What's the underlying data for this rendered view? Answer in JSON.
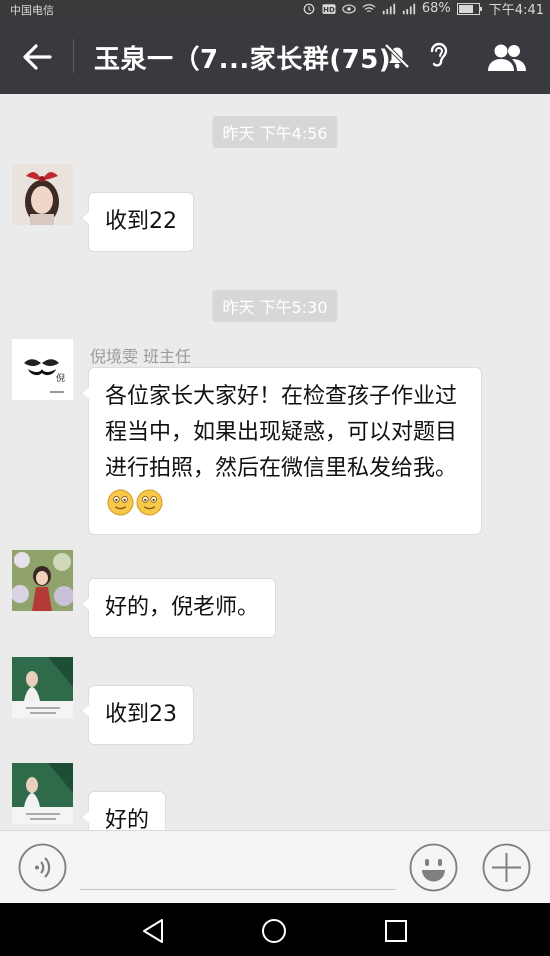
{
  "status_bar": {
    "carrier": "中国电信",
    "battery": "68%",
    "time": "下午4:41"
  },
  "header": {
    "title": "玉泉一（7...家长群(75)",
    "icons": [
      "back-arrow-icon",
      "mute-bell-icon",
      "ear-icon",
      "group-members-icon"
    ]
  },
  "chat": {
    "timestamps": [
      "昨天 下午4:56",
      "昨天 下午5:30"
    ],
    "messages": [
      {
        "sender": "",
        "text": "收到22"
      },
      {
        "sender": "倪境雯 班主任",
        "text": "各位家长大家好！在检查孩子作业过程当中，如果出现疑惑，可以对题目进行拍照，然后在微信里私发给我。"
      },
      {
        "sender": "",
        "text": "好的，倪老师。"
      },
      {
        "sender": "",
        "text": "收到23"
      },
      {
        "sender": "",
        "text": "好的"
      }
    ],
    "emoji_suffix": [
      "smiley-emoji",
      "smiley-emoji"
    ]
  },
  "input_bar": {
    "icons": [
      "voice-icon",
      "emoji-icon",
      "plus-icon"
    ]
  },
  "nav_bar": {
    "icons": [
      "nav-back-icon",
      "nav-home-icon",
      "nav-recent-icon"
    ]
  },
  "colors": {
    "header_bg": "#393a3f",
    "chat_bg": "#ebebeb",
    "bubble_bg": "#ffffff",
    "timestamp_bg": "#d7d7d7"
  }
}
